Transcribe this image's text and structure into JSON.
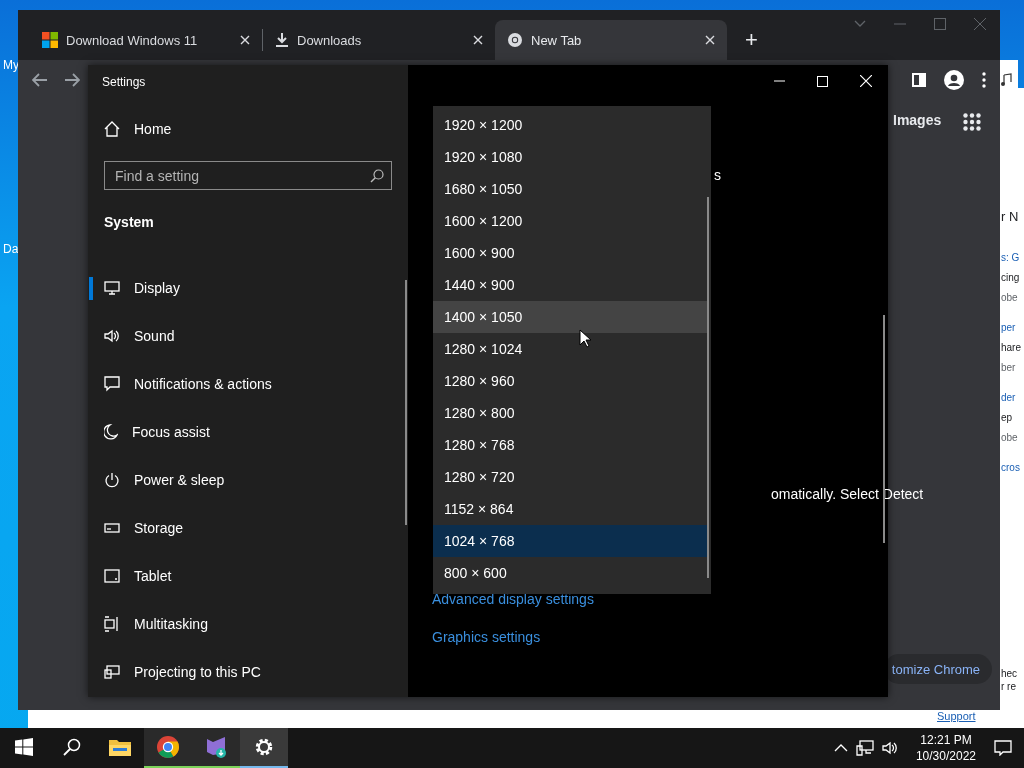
{
  "desktop": {
    "icons": [
      {
        "label": "My"
      },
      {
        "label": "Da"
      }
    ],
    "back_window": {
      "fragments": [
        {
          "text": "r N",
          "kind": "heading"
        },
        {
          "text": "s: G",
          "kind": "link"
        },
        {
          "text": "cing",
          "kind": "text"
        },
        {
          "text": "obe",
          "kind": "muted"
        },
        {
          "text": "per",
          "kind": "link"
        },
        {
          "text": "hare",
          "kind": "text"
        },
        {
          "text": "ber",
          "kind": "muted"
        },
        {
          "text": "der",
          "kind": "link"
        },
        {
          "text": "ep",
          "kind": "text"
        },
        {
          "text": "obe",
          "kind": "muted"
        },
        {
          "text": "cros",
          "kind": "link"
        }
      ],
      "footer": [
        {
          "text": "hec",
          "kind": "text"
        },
        {
          "text": "r re",
          "kind": "text"
        }
      ],
      "support_link": "Support"
    }
  },
  "browser": {
    "tabs": [
      {
        "title": "Download Windows 11",
        "selected": false
      },
      {
        "title": "Downloads",
        "selected": false
      },
      {
        "title": "New Tab",
        "selected": true
      }
    ],
    "new_tab_button": "+",
    "page": {
      "images_link": "Images",
      "customize_button": "tomize Chrome"
    }
  },
  "settings": {
    "title": "Settings",
    "home": "Home",
    "search": {
      "placeholder": "Find a setting"
    },
    "section": "System",
    "nav": [
      {
        "label": "Display",
        "selected": true
      },
      {
        "label": "Sound",
        "selected": false
      },
      {
        "label": "Notifications & actions",
        "selected": false
      },
      {
        "label": "Focus assist",
        "selected": false
      },
      {
        "label": "Power & sleep",
        "selected": false
      },
      {
        "label": "Storage",
        "selected": false
      },
      {
        "label": "Tablet",
        "selected": false
      },
      {
        "label": "Multitasking",
        "selected": false
      },
      {
        "label": "Projecting to this PC",
        "selected": false
      }
    ],
    "content": {
      "fragment_top": "s",
      "fragment_mid": "omatically. Select Detect",
      "links": [
        "Advanced display settings",
        "Graphics settings"
      ]
    },
    "resolution_list": [
      {
        "label": "1920 × 1200",
        "selected": false,
        "hovered": false
      },
      {
        "label": "1920 × 1080",
        "selected": false,
        "hovered": false
      },
      {
        "label": "1680 × 1050",
        "selected": false,
        "hovered": false
      },
      {
        "label": "1600 × 1200",
        "selected": false,
        "hovered": false
      },
      {
        "label": "1600 × 900",
        "selected": false,
        "hovered": false
      },
      {
        "label": "1440 × 900",
        "selected": false,
        "hovered": false
      },
      {
        "label": "1400 × 1050",
        "selected": false,
        "hovered": true
      },
      {
        "label": "1280 × 1024",
        "selected": false,
        "hovered": false
      },
      {
        "label": "1280 × 960",
        "selected": false,
        "hovered": false
      },
      {
        "label": "1280 × 800",
        "selected": false,
        "hovered": false
      },
      {
        "label": "1280 × 768",
        "selected": false,
        "hovered": false
      },
      {
        "label": "1280 × 720",
        "selected": false,
        "hovered": false
      },
      {
        "label": "1152 × 864",
        "selected": false,
        "hovered": false
      },
      {
        "label": "1024 × 768",
        "selected": true,
        "hovered": false
      },
      {
        "label": "800 × 600",
        "selected": false,
        "hovered": false
      }
    ]
  },
  "taskbar": {
    "apps": [
      {
        "running": false,
        "active": false
      },
      {
        "running": false,
        "active": false
      },
      {
        "running": false,
        "active": false
      },
      {
        "running": true,
        "active": false
      },
      {
        "running": true,
        "active": false
      },
      {
        "running": true,
        "active": true
      }
    ],
    "time": "12:21 PM",
    "date": "10/30/2022"
  }
}
